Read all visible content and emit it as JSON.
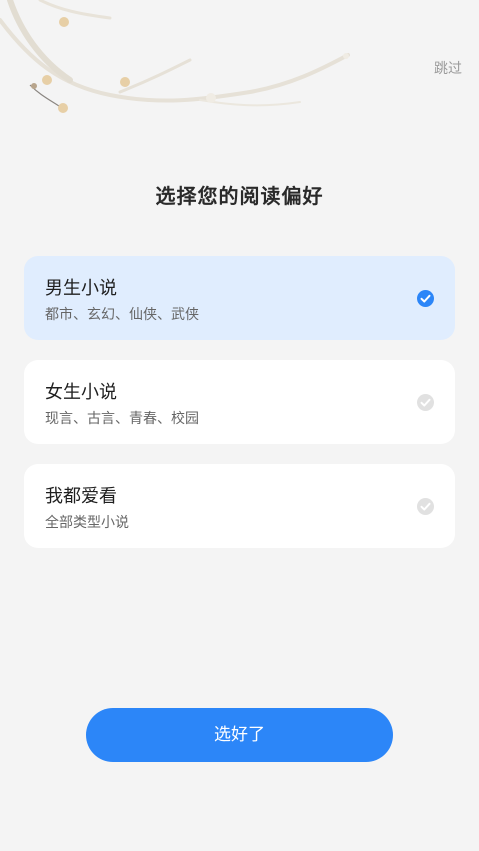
{
  "header": {
    "skip_label": "跳过",
    "title": "选择您的阅读偏好"
  },
  "options": [
    {
      "title": "男生小说",
      "subtitle": "都市、玄幻、仙侠、武侠",
      "selected": true
    },
    {
      "title": "女生小说",
      "subtitle": "现言、古言、青春、校园",
      "selected": false
    },
    {
      "title": "我都爱看",
      "subtitle": "全部类型小说",
      "selected": false
    }
  ],
  "footer": {
    "confirm_label": "选好了"
  },
  "colors": {
    "accent": "#2c86f8",
    "selected_card_bg": "#e0edfe",
    "page_bg": "#f4f4f4"
  },
  "icons": {
    "decoration": "plum-blossom-branch-icon",
    "check": "check-circle-icon"
  }
}
